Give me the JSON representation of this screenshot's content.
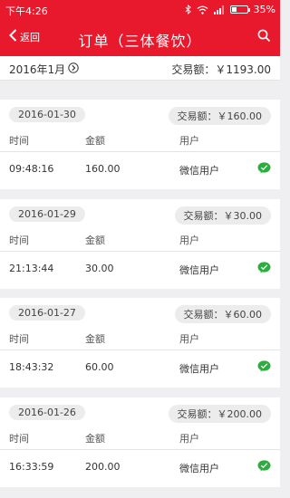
{
  "status_bar": {
    "time": "下午4:26",
    "battery": "35%",
    "battery_level": 0.35
  },
  "nav": {
    "back_label": "返回",
    "title": "订单（三体餐饮）"
  },
  "summary": {
    "month": "2016年1月",
    "total": "交易额：￥1193.00"
  },
  "columns": {
    "time": "时间",
    "amount": "金额",
    "user": "用户"
  },
  "days": [
    {
      "date": "2016-01-30",
      "total": "交易额：￥160.00",
      "time": "09:48:16",
      "amount": "160.00",
      "user": "微信用户"
    },
    {
      "date": "2016-01-29",
      "total": "交易额：￥30.00",
      "time": "21:13:44",
      "amount": "30.00",
      "user": "微信用户"
    },
    {
      "date": "2016-01-27",
      "total": "交易额：￥60.00",
      "time": "18:43:32",
      "amount": "60.00",
      "user": "微信用户"
    },
    {
      "date": "2016-01-26",
      "total": "交易额：￥200.00",
      "time": "16:33:59",
      "amount": "200.00",
      "user": "微信用户"
    }
  ],
  "icons": {
    "back": "chevron-left-icon",
    "search": "search-icon",
    "month": "chevron-right-circle-icon",
    "payment": "wechat-icon"
  },
  "colors": {
    "brand": "#e8192c",
    "wechat": "#2aae3e"
  }
}
